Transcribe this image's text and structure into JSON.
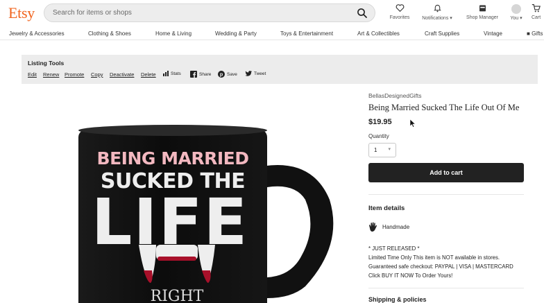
{
  "header": {
    "logo": "Etsy",
    "search_placeholder": "Search for items or shops",
    "nav": {
      "favorites": "Favorites",
      "notifications": "Notifications",
      "shop_manager": "Shop Manager",
      "you": "You",
      "cart": "Cart"
    }
  },
  "categories": [
    "Jewelry & Accessories",
    "Clothing & Shoes",
    "Home & Living",
    "Wedding & Party",
    "Toys & Entertainment",
    "Art & Collectibles",
    "Craft Supplies",
    "Vintage",
    "Gifts"
  ],
  "listing_tools": {
    "title": "Listing Tools",
    "links": [
      "Edit",
      "Renew",
      "Promote",
      "Copy",
      "Deactivate",
      "Delete"
    ],
    "stats": "Stats",
    "share": "Share",
    "save": "Save",
    "tweet": "Tweet"
  },
  "mug": {
    "line1": "BEING MARRIED",
    "line2": "SUCKED THE",
    "line3": "LIFE",
    "line4": "RIGHT"
  },
  "product": {
    "shop_name": "BellasDesignedGifts",
    "title": "Being Married Sucked The Life Out Of Me",
    "price": "$19.95",
    "quantity_label": "Quantity",
    "quantity_value": "1",
    "add_to_cart": "Add to cart",
    "item_details_heading": "Item details",
    "handmade": "Handmade",
    "description": [
      "* JUST RELEASED *",
      "Limited Time Only This item is NOT available in stores.",
      "Guaranteed safe checkout: PAYPAL | VISA | MASTERCARD",
      "Click BUY IT NOW  To Order Yours!"
    ],
    "shipping_heading": "Shipping & policies"
  },
  "colors": {
    "brand": "#f1641e",
    "button": "#222222",
    "tools_bg": "#ececec"
  }
}
